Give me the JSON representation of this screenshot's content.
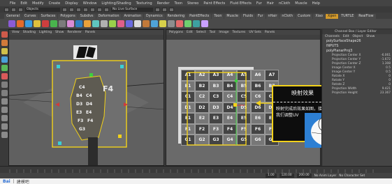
{
  "menubar": {
    "items": [
      "File",
      "Edit",
      "Modify",
      "Create",
      "Display",
      "Window",
      "Lighting/Shading",
      "Texturing",
      "Render",
      "Toon",
      "Stereo",
      "Paint Effects",
      "Fluid Effects",
      "Fur",
      "Hair",
      "nCloth",
      "Muscle",
      "Help"
    ]
  },
  "status": {
    "mode": "Objects",
    "live_surface": "No Live Surface"
  },
  "shelf": {
    "tabs": [
      "General",
      "Curves",
      "Surfaces",
      "Polygons",
      "Subdivs",
      "Deformation",
      "Animation",
      "Dynamics",
      "Rendering",
      "PaintEffects",
      "Toon",
      "Muscle",
      "Fluids",
      "Fur",
      "nHair",
      "nCloth",
      "Custom",
      "Xiao",
      "Xgen",
      "TURTLE",
      "RealFlow"
    ],
    "active": "Xgen"
  },
  "viewport_left": {
    "menu": [
      "View",
      "Shading",
      "Lighting",
      "Show",
      "Renderer",
      "Panels"
    ]
  },
  "viewport_right": {
    "menu": [
      "Polygons",
      "Edit",
      "Select",
      "Tool",
      "Image",
      "Textures",
      "UV Sets",
      "Panels"
    ]
  },
  "channelbox": {
    "header": "Channel Box / Layer Editor",
    "tabs": [
      "Channels",
      "Edit",
      "Object",
      "Show"
    ],
    "node": "polySurfaceShape26",
    "inputs_label": "INPUTS",
    "proj": "polyPlanarProj3",
    "attrs": [
      [
        "Projection Center X",
        "-6.061"
      ],
      [
        "Projection Center Y",
        "-1.672"
      ],
      [
        "Projection Center Z",
        "1.308"
      ],
      [
        "Image Center X",
        "0.5"
      ],
      [
        "Image Center Y",
        "0.5"
      ],
      [
        "Rotate X",
        "0"
      ],
      [
        "Rotate Y",
        "0"
      ],
      [
        "Rotate Z",
        "0"
      ],
      [
        "Projection Width",
        "9.421"
      ],
      [
        "Projection Height",
        "23.367"
      ]
    ]
  },
  "uv": {
    "cells": [
      [
        "A1",
        "A2",
        "A3",
        "A4",
        "A5"
      ],
      [
        "B1",
        "B2",
        "B3",
        "B4",
        "B5"
      ],
      [
        "C1",
        "C2",
        "C3",
        "C4",
        "C5"
      ],
      [
        "D1",
        "D2",
        "D3",
        "D4",
        "D5"
      ],
      [
        "E1",
        "E2",
        "E3",
        "E4",
        "E5"
      ],
      [
        "F1",
        "F2",
        "F3",
        "F4",
        "F5"
      ],
      [
        "G1",
        "G2",
        "G3",
        "G4",
        "G5"
      ]
    ],
    "col6": [
      "A6",
      "B6",
      "C6",
      "D6",
      "E6",
      "F6",
      "G6"
    ],
    "col7": [
      "A7",
      "B7",
      "C7",
      "D7",
      "E7",
      "F7",
      "G7"
    ]
  },
  "callout": {
    "title": "映射效果",
    "body": "映射完成后效果如图，接下来我们调整UV"
  },
  "range": {
    "start": "1.00",
    "end": "120.00",
    "end2": "200.00",
    "anim_layer": "No Anim Layer",
    "char_set": "No Character Set"
  },
  "watermark": {
    "brand": "Bai",
    "sub": "建模吧"
  },
  "colors": {
    "accent": "#d39a2c",
    "highlight": "#f2d11a",
    "callout_bg": "#0d0d0d"
  }
}
